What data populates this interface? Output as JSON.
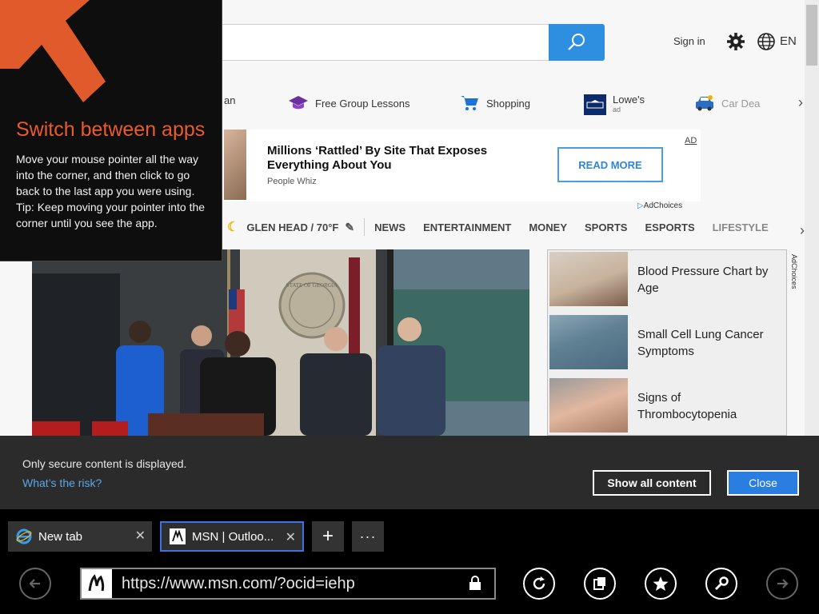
{
  "header": {
    "signin_label": "Sign in",
    "language": "EN"
  },
  "quicklinks": {
    "items": [
      {
        "label": "an",
        "icon": "partial-link"
      },
      {
        "label": "Free Group Lessons",
        "icon": "graduation-cap-icon"
      },
      {
        "label": "Shopping",
        "icon": "shopping-cart-icon"
      },
      {
        "label": "Lowe's",
        "sublabel": "ad",
        "icon": "lowes-logo"
      },
      {
        "label": "Car Dea",
        "icon": "car-icon"
      }
    ]
  },
  "ad": {
    "title": "Millions ‘Rattled’ By Site That Exposes Everything About You",
    "source": "People Whiz",
    "cta": "READ MORE",
    "label": "AD",
    "adchoices": "AdChoices"
  },
  "nav": {
    "location": "GLEN HEAD / 70°F",
    "items": [
      "NEWS",
      "ENTERTAINMENT",
      "MONEY",
      "SPORTS",
      "ESPORTS",
      "LIFESTYLE"
    ]
  },
  "sidebar": {
    "adchoices": "AdChoices",
    "items": [
      {
        "text": "Blood Pressure Chart by Age"
      },
      {
        "text": "Small Cell Lung Cancer Symptoms"
      },
      {
        "text": "Signs of Thrombocytopenia"
      }
    ]
  },
  "photo": {
    "seal_text": "STATE OF GEORGIA"
  },
  "notice": {
    "message": "Only secure content is displayed.",
    "link": "What’s the risk?",
    "show_all_label": "Show all content",
    "close_label": "Close"
  },
  "tabs": [
    {
      "title": "New tab",
      "active": false
    },
    {
      "title": "MSN | Outloo...",
      "active": true
    }
  ],
  "addressbar": {
    "url": "https://www.msn.com/?ocid=iehp"
  },
  "switch_apps": {
    "title": "Switch between apps",
    "body1": "Move your mouse pointer all the way into the corner, and then click to go back to the last app you were using.",
    "body2": "Tip: Keep moving your pointer into the corner until you see the app."
  },
  "colors": {
    "accent": "#2a7de1",
    "switch_title": "#ea5a2a",
    "search_button": "#2e8fe0"
  }
}
